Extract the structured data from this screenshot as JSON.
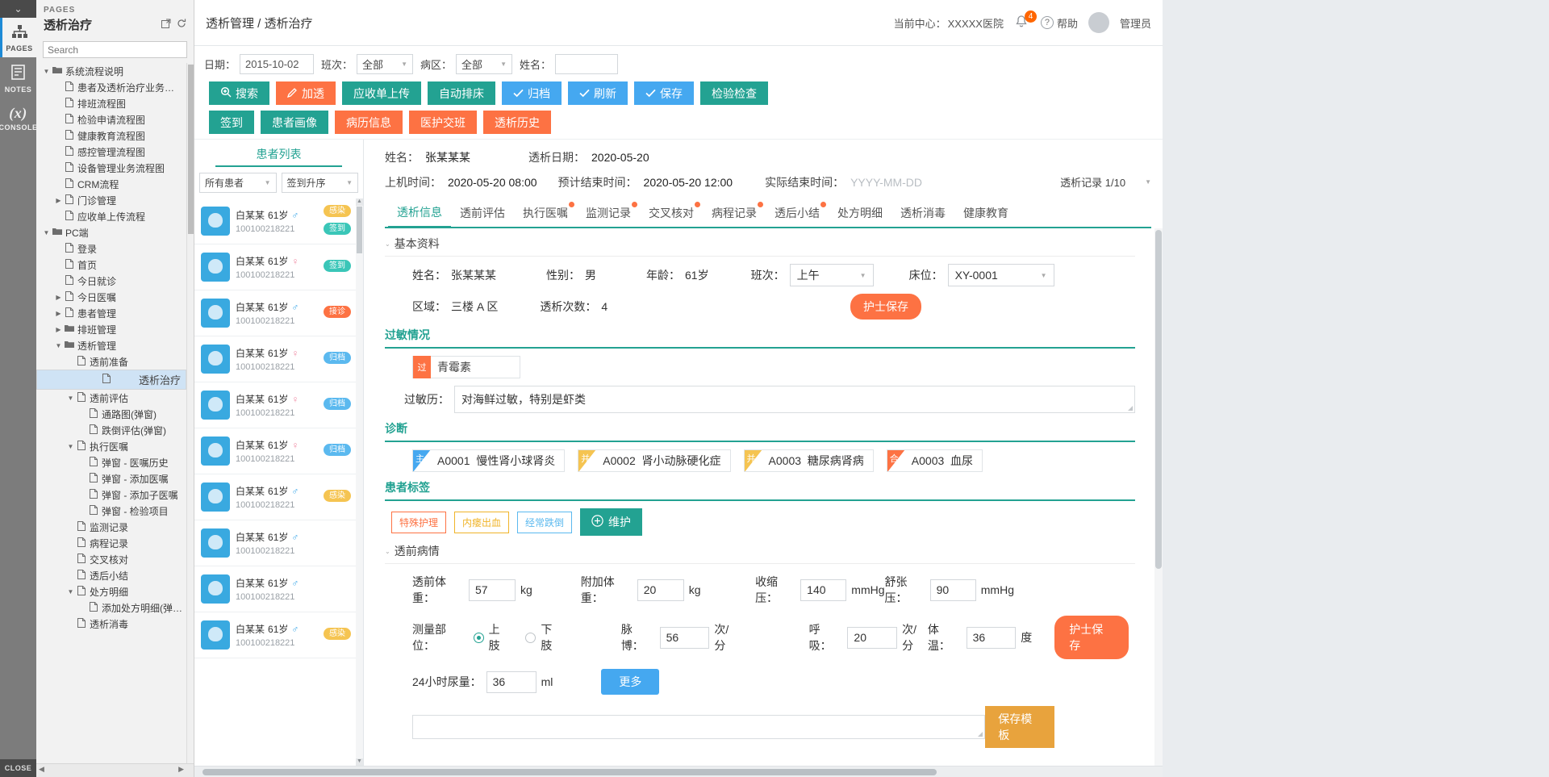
{
  "rail": {
    "collapse_icon": "chevron-down",
    "items": [
      {
        "label": "PAGES",
        "icon": "sitemap-icon"
      },
      {
        "label": "NOTES",
        "icon": "notes-icon"
      },
      {
        "label": "CONSOLE",
        "icon": "(x)"
      }
    ],
    "close_label": "CLOSE"
  },
  "pages": {
    "kicker": "PAGES",
    "title": "透析治疗",
    "search_placeholder": "Search",
    "tree": [
      {
        "d": 0,
        "tw": "▼",
        "ico": "folder",
        "label": "系统流程说明"
      },
      {
        "d": 1,
        "tw": "",
        "ico": "page",
        "label": "患者及透析治疗业务流程"
      },
      {
        "d": 1,
        "tw": "",
        "ico": "page",
        "label": "排班流程图"
      },
      {
        "d": 1,
        "tw": "",
        "ico": "page",
        "label": "检验申请流程图"
      },
      {
        "d": 1,
        "tw": "",
        "ico": "page",
        "label": "健康教育流程图"
      },
      {
        "d": 1,
        "tw": "",
        "ico": "page",
        "label": "感控管理流程图"
      },
      {
        "d": 1,
        "tw": "",
        "ico": "page",
        "label": "设备管理业务流程图"
      },
      {
        "d": 1,
        "tw": "",
        "ico": "page",
        "label": "CRM流程"
      },
      {
        "d": 1,
        "tw": "▶",
        "ico": "page",
        "label": "门诊管理"
      },
      {
        "d": 1,
        "tw": "",
        "ico": "page",
        "label": "应收单上传流程"
      },
      {
        "d": 0,
        "tw": "▼",
        "ico": "folder",
        "label": "PC端"
      },
      {
        "d": 1,
        "tw": "",
        "ico": "page",
        "label": "登录"
      },
      {
        "d": 1,
        "tw": "",
        "ico": "page",
        "label": "首页"
      },
      {
        "d": 1,
        "tw": "",
        "ico": "page",
        "label": "今日就诊"
      },
      {
        "d": 1,
        "tw": "▶",
        "ico": "page",
        "label": "今日医嘱"
      },
      {
        "d": 1,
        "tw": "▶",
        "ico": "page",
        "label": "患者管理"
      },
      {
        "d": 1,
        "tw": "▶",
        "ico": "folder",
        "label": "排班管理"
      },
      {
        "d": 1,
        "tw": "▼",
        "ico": "folder",
        "label": "透析管理"
      },
      {
        "d": 2,
        "tw": "",
        "ico": "page",
        "label": "透前准备"
      },
      {
        "d": 2,
        "tw": "",
        "ico": "page",
        "label": "透析治疗",
        "selected": true
      },
      {
        "d": 2,
        "tw": "▼",
        "ico": "page",
        "label": "透前评估"
      },
      {
        "d": 3,
        "tw": "",
        "ico": "page",
        "label": "通路图(弹窗)"
      },
      {
        "d": 3,
        "tw": "",
        "ico": "page",
        "label": "跌倒评估(弹窗)"
      },
      {
        "d": 2,
        "tw": "▼",
        "ico": "page",
        "label": "执行医嘱"
      },
      {
        "d": 3,
        "tw": "",
        "ico": "page",
        "label": "弹窗 - 医嘱历史"
      },
      {
        "d": 3,
        "tw": "",
        "ico": "page",
        "label": "弹窗 - 添加医嘱"
      },
      {
        "d": 3,
        "tw": "",
        "ico": "page",
        "label": "弹窗 - 添加子医嘱"
      },
      {
        "d": 3,
        "tw": "",
        "ico": "page",
        "label": "弹窗 - 检验项目"
      },
      {
        "d": 2,
        "tw": "",
        "ico": "page",
        "label": "监测记录"
      },
      {
        "d": 2,
        "tw": "",
        "ico": "page",
        "label": "病程记录"
      },
      {
        "d": 2,
        "tw": "",
        "ico": "page",
        "label": "交叉核对"
      },
      {
        "d": 2,
        "tw": "",
        "ico": "page",
        "label": "透后小结"
      },
      {
        "d": 2,
        "tw": "▼",
        "ico": "page",
        "label": "处方明细"
      },
      {
        "d": 3,
        "tw": "",
        "ico": "page",
        "label": "添加处方明细(弹窗)"
      },
      {
        "d": 2,
        "tw": "",
        "ico": "page",
        "label": "透析消毒"
      }
    ]
  },
  "header": {
    "breadcrumb": "透析管理 / 透析治疗",
    "center_label": "当前中心：",
    "center_value": "XXXXX医院",
    "notification_count": "4",
    "help_label": "帮助",
    "user_label": "管理员"
  },
  "filters": {
    "date_label": "日期：",
    "date_value": "2015-10-02",
    "shift_label": "班次：",
    "shift_value": "全部",
    "ward_label": "病区：",
    "ward_value": "全部",
    "name_label": "姓名：",
    "name_value": "",
    "buttons": [
      {
        "label": "搜索",
        "style": "b-teal",
        "icon": "search-icon"
      },
      {
        "label": "加透",
        "style": "b-orange",
        "icon": "pencil-icon"
      },
      {
        "label": "应收单上传",
        "style": "b-teal"
      },
      {
        "label": "自动排床",
        "style": "b-teal"
      },
      {
        "label": "归档",
        "style": "b-blue",
        "icon": "check-icon"
      },
      {
        "label": "刷新",
        "style": "b-blue",
        "icon": "check-icon"
      },
      {
        "label": "保存",
        "style": "b-blue",
        "icon": "check-icon"
      },
      {
        "label": "检验检查",
        "style": "b-teal"
      },
      {
        "label": "签到",
        "style": "b-teal"
      },
      {
        "label": "患者画像",
        "style": "b-teal"
      },
      {
        "label": "病历信息",
        "style": "b-orange"
      },
      {
        "label": "医护交班",
        "style": "b-orange"
      },
      {
        "label": "透析历史",
        "style": "b-orange"
      }
    ]
  },
  "patient_list": {
    "tab_label": "患者列表",
    "filter_all": "所有患者",
    "filter_sort": "签到升序",
    "items": [
      {
        "name": "白某某",
        "age": "61岁",
        "sex": "♂",
        "sex_class": "m",
        "id": "100100218221",
        "tags": [
          {
            "t": "感染",
            "c": "t-gan"
          },
          {
            "t": "签到",
            "c": "t-qd"
          }
        ]
      },
      {
        "name": "白某某",
        "age": "61岁",
        "sex": "♀",
        "sex_class": "f",
        "id": "100100218221",
        "tags": [
          {
            "t": "签到",
            "c": "t-qd"
          }
        ]
      },
      {
        "name": "白某某",
        "age": "61岁",
        "sex": "♂",
        "sex_class": "m",
        "id": "100100218221",
        "tags": [
          {
            "t": "接诊",
            "c": "t-jz"
          }
        ]
      },
      {
        "name": "白某某",
        "age": "61岁",
        "sex": "♀",
        "sex_class": "f",
        "id": "100100218221",
        "tags": [
          {
            "t": "归档",
            "c": "t-gd"
          }
        ]
      },
      {
        "name": "白某某",
        "age": "61岁",
        "sex": "♀",
        "sex_class": "f",
        "id": "100100218221",
        "tags": [
          {
            "t": "归档",
            "c": "t-gd"
          }
        ]
      },
      {
        "name": "白某某",
        "age": "61岁",
        "sex": "♀",
        "sex_class": "f",
        "id": "100100218221",
        "tags": [
          {
            "t": "归档",
            "c": "t-gd"
          }
        ]
      },
      {
        "name": "白某某",
        "age": "61岁",
        "sex": "♂",
        "sex_class": "m",
        "id": "100100218221",
        "tags": [
          {
            "t": "感染",
            "c": "t-gan"
          }
        ]
      },
      {
        "name": "白某某",
        "age": "61岁",
        "sex": "♂",
        "sex_class": "m",
        "id": "100100218221",
        "tags": []
      },
      {
        "name": "白某某",
        "age": "61岁",
        "sex": "♂",
        "sex_class": "m",
        "id": "100100218221",
        "tags": []
      },
      {
        "name": "白某某",
        "age": "61岁",
        "sex": "♂",
        "sex_class": "m",
        "id": "100100218221",
        "tags": [
          {
            "t": "感染",
            "c": "t-gan"
          }
        ]
      }
    ]
  },
  "patient": {
    "name_label": "姓名：",
    "name_value": "张某某某",
    "dialysis_date_label": "透析日期：",
    "dialysis_date_value": "2020-05-20",
    "start_label": "上机时间：",
    "start_value": "2020-05-20  08:00",
    "expect_end_label": "预计结束时间：",
    "expect_end_value": "2020-05-20  12:00",
    "actual_end_label": "实际结束时间：",
    "actual_end_placeholder": "YYYY-MM-DD",
    "record_label": "透析记录",
    "record_value": "1/10"
  },
  "tabs": [
    {
      "label": "透析信息",
      "active": true,
      "dot": false
    },
    {
      "label": "透前评估",
      "active": false,
      "dot": false
    },
    {
      "label": "执行医嘱",
      "active": false,
      "dot": true
    },
    {
      "label": "监测记录",
      "active": false,
      "dot": true
    },
    {
      "label": "交叉核对",
      "active": false,
      "dot": true
    },
    {
      "label": "病程记录",
      "active": false,
      "dot": true
    },
    {
      "label": "透后小结",
      "active": false,
      "dot": true
    },
    {
      "label": "处方明细",
      "active": false,
      "dot": false
    },
    {
      "label": "透析消毒",
      "active": false,
      "dot": false
    },
    {
      "label": "健康教育",
      "active": false,
      "dot": false
    }
  ],
  "basic": {
    "section_title": "基本资料",
    "name_label": "姓名：",
    "name_value": "张某某某",
    "sex_label": "性别：",
    "sex_value": "男",
    "age_label": "年龄：",
    "age_value": "61岁",
    "shift_label": "班次：",
    "shift_value": "上午",
    "bed_label": "床位：",
    "bed_value": "XY-0001",
    "area_label": "区域：",
    "area_value": "三楼 A 区",
    "count_label": "透析次数：",
    "count_value": "4",
    "save_button": "护士保存"
  },
  "allergy": {
    "section_title": "过敏情况",
    "chip_flag": "过",
    "chip_text": "青霉素",
    "history_label": "过敏历：",
    "history_value": "对海鲜过敏，特别是虾类"
  },
  "diagnosis": {
    "section_title": "诊断",
    "items": [
      {
        "flag": "主",
        "color": "#45a8f0",
        "code": "A0001",
        "text": "慢性肾小球肾炎"
      },
      {
        "flag": "并",
        "color": "#f5c451",
        "code": "A0002",
        "text": "肾小动脉硬化症"
      },
      {
        "flag": "并",
        "color": "#f5c451",
        "code": "A0003",
        "text": "糖尿病肾病"
      },
      {
        "flag": "合",
        "color": "#fd7243",
        "code": "A0003",
        "text": "血尿"
      }
    ]
  },
  "patient_tags": {
    "section_title": "患者标签",
    "tags": [
      {
        "label": "特殊护理",
        "color": "r"
      },
      {
        "label": "内瘘出血",
        "color": "y"
      },
      {
        "label": "经常跌倒",
        "color": "b"
      }
    ],
    "maintain_button": "维护"
  },
  "pre_dialysis": {
    "section_title": "透前病情",
    "weight_label": "透前体重：",
    "weight_value": "57",
    "weight_unit": "kg",
    "extra_label": "附加体重：",
    "extra_value": "20",
    "extra_unit": "kg",
    "sbp_label": "收缩压：",
    "sbp_value": "140",
    "sbp_unit": "mmHg",
    "dbp_label": "舒张压：",
    "dbp_value": "90",
    "dbp_unit": "mmHg",
    "site_label": "测量部位：",
    "site_upper": "上肢",
    "site_lower": "下肢",
    "site_selected": "上肢",
    "pulse_label": "脉博：",
    "pulse_value": "56",
    "pulse_unit": "次/分",
    "resp_label": "呼吸：",
    "resp_value": "20",
    "resp_unit": "次/分",
    "temp_label": "体温：",
    "temp_value": "36",
    "temp_unit": "度",
    "urine_label": "24小时尿量：",
    "urine_value": "36",
    "urine_unit": "ml",
    "more_button": "更多",
    "nurse_save_button": "护士保存",
    "save_template_button": "保存模板"
  }
}
